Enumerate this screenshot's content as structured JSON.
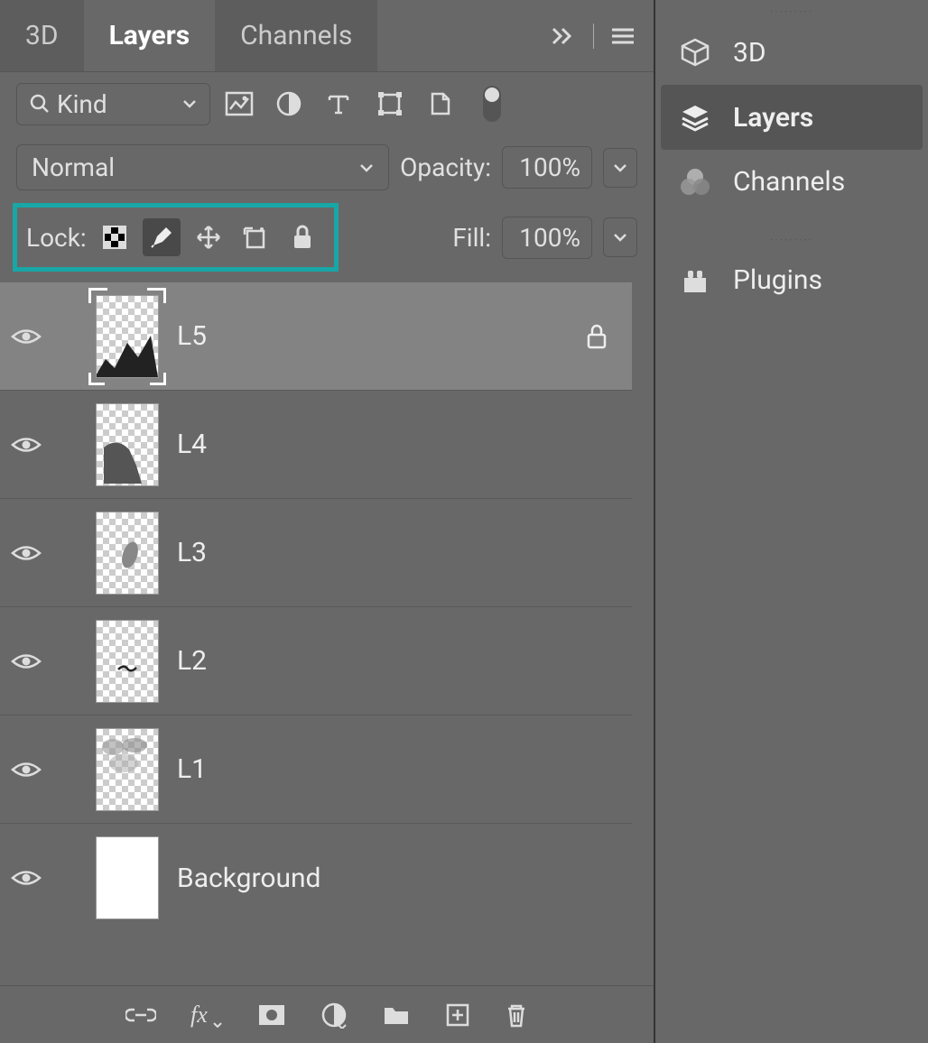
{
  "tabs": {
    "t0": "3D",
    "t1": "Layers",
    "t2": "Channels",
    "active": 1
  },
  "filter": {
    "kind_label": "Kind"
  },
  "blend": {
    "mode": "Normal"
  },
  "opacity": {
    "label": "Opacity:",
    "value": "100%"
  },
  "lock": {
    "label": "Lock:"
  },
  "fill": {
    "label": "Fill:",
    "value": "100%"
  },
  "layers": [
    {
      "name": "L5",
      "selected": true,
      "locked": true
    },
    {
      "name": "L4",
      "selected": false,
      "locked": false
    },
    {
      "name": "L3",
      "selected": false,
      "locked": false
    },
    {
      "name": "L2",
      "selected": false,
      "locked": false
    },
    {
      "name": "L1",
      "selected": false,
      "locked": false
    },
    {
      "name": "Background",
      "selected": false,
      "locked": false,
      "solid": true
    }
  ],
  "side_panel": {
    "items": [
      {
        "label": "3D"
      },
      {
        "label": "Layers",
        "active": true
      },
      {
        "label": "Channels"
      },
      {
        "label": "Plugins"
      }
    ]
  },
  "colors": {
    "highlight": "#18a6a6"
  }
}
